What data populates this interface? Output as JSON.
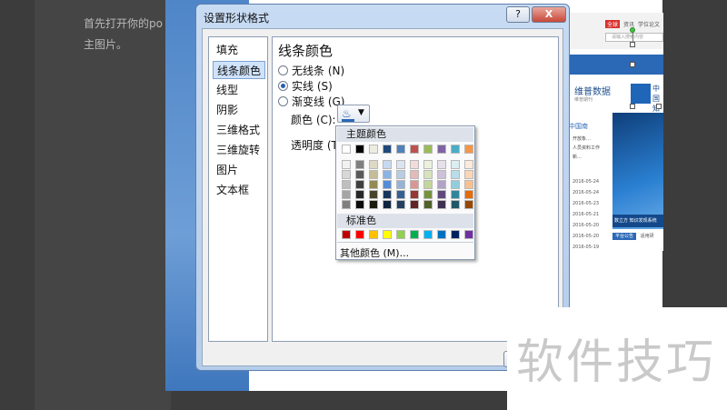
{
  "document": {
    "line1": "首先打开你的po",
    "line2": "主图片。"
  },
  "web_preview": {
    "tabs": [
      "全球",
      "资讯",
      "学位论文"
    ],
    "search_placeholder": "请输入搜索内容",
    "logo_name": "维普数据",
    "logo_sub": "维普期刊",
    "cnki": "中国知",
    "news_title": "中国南",
    "news_lines": [
      "开放象…",
      "人员资料工作",
      "新…"
    ],
    "dates": [
      "2016-05-24",
      "2016-05-24",
      "2016-05-23",
      "2016-05-21",
      "2016-05-20",
      "2016-05-20",
      "2016-05-19"
    ],
    "image_caption": "数立方 知识发现系统",
    "footer_btn": "平台公告",
    "footer_extra": "适用研"
  },
  "dialog": {
    "title": "设置形状格式",
    "help_label": "?",
    "close_label": "X",
    "categories": [
      "填充",
      "线条颜色",
      "线型",
      "阴影",
      "三维格式",
      "三维旋转",
      "图片",
      "文本框"
    ],
    "selected_category": "线条颜色",
    "pane_title": "线条颜色",
    "options": [
      "无线条 (N)",
      "实线 (S)",
      "渐变线 (G)"
    ],
    "selected_option": "实线 (S)",
    "color_label": "颜色 (C):",
    "transparency_label": "透明度 (T):",
    "bucket_icon": "paint-bucket-icon",
    "dropdown_icon": "chevron-down-icon"
  },
  "palette": {
    "theme_header": "主题颜色",
    "standard_header": "标准色",
    "more_colors": "其他颜色 (M)...",
    "theme_top": [
      "#ffffff",
      "#000000",
      "#eeece1",
      "#1f497d",
      "#4f81bd",
      "#c0504d",
      "#9bbb59",
      "#8064a2",
      "#4bacc6",
      "#f79646"
    ],
    "theme_shades": [
      [
        "#f2f2f2",
        "#d8d8d8",
        "#bfbfbf",
        "#a5a5a5",
        "#7f7f7f"
      ],
      [
        "#7f7f7f",
        "#595959",
        "#3f3f3f",
        "#262626",
        "#0c0c0c"
      ],
      [
        "#ddd9c3",
        "#c4bd97",
        "#938953",
        "#494429",
        "#1d1b10"
      ],
      [
        "#c6d9f0",
        "#8db3e2",
        "#548dd4",
        "#17365d",
        "#0f243e"
      ],
      [
        "#dbe5f1",
        "#b8cce4",
        "#95b3d7",
        "#366092",
        "#244061"
      ],
      [
        "#f2dcdb",
        "#e5b9b7",
        "#d99694",
        "#953734",
        "#632423"
      ],
      [
        "#ebf1dd",
        "#d7e3bc",
        "#c3d69b",
        "#76923c",
        "#4f6128"
      ],
      [
        "#e5e0ec",
        "#ccc1d9",
        "#b2a2c7",
        "#5f497a",
        "#3f3151"
      ],
      [
        "#dbeef3",
        "#b7dde8",
        "#92cddc",
        "#31859b",
        "#205867"
      ],
      [
        "#fdeada",
        "#fbd5b5",
        "#fac08f",
        "#e36c09",
        "#974806"
      ]
    ],
    "standard": [
      "#c00000",
      "#ff0000",
      "#ffc000",
      "#ffff00",
      "#92d050",
      "#00b050",
      "#00b0f0",
      "#0070c0",
      "#002060",
      "#7030a0"
    ]
  },
  "watermark": {
    "text": "软件技巧"
  }
}
